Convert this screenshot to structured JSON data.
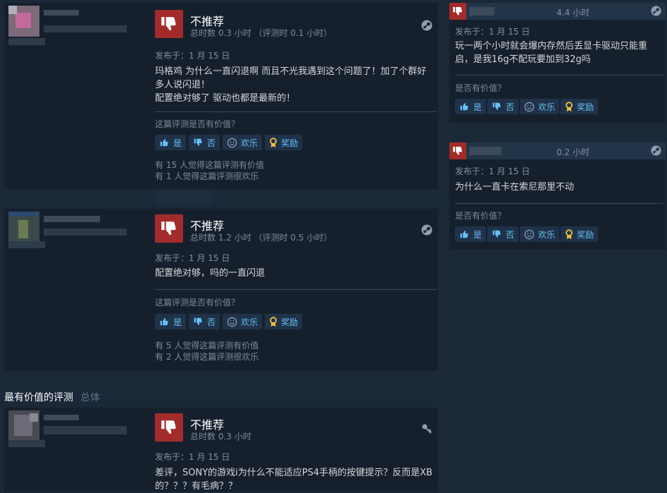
{
  "labels": {
    "not_recommended": "不推荐",
    "helpful_question": "这篇评测是否有价值？",
    "helpful_question_short": "是否有价值？",
    "yes": "是",
    "no": "否",
    "funny": "欢乐",
    "award": "奖励"
  },
  "reviews": [
    {
      "hours": "总时数 0.3 小时 （评测时 0.1 小时）",
      "posted": "发布于：1 月 15 日",
      "text_lines": [
        "玛格鸡 为什么一直闪退啊 而且不光我遇到这个问题了！加了个群好",
        "多人说闪退！",
        "配置绝对够了 驱动也都是最新的！"
      ],
      "helpful_count": "有 15 人觉得这篇评测有价值",
      "funny_count": "有 1 人觉得这篇评测很欢乐"
    },
    {
      "hours": "总时数 1.2 小时 （评测时 0.5 小时）",
      "posted": "发布于：1 月 15 日",
      "text_lines": [
        "配置绝对够，吗的一直闪退"
      ],
      "helpful_count": "有 5 人觉得这篇评测有价值",
      "funny_count": "有 2 人觉得这篇评测很欢乐"
    },
    {
      "hours": "总时数 0.3 小时",
      "posted": "发布于：1 月 15 日",
      "text_lines": [
        "差评，SONY的游戏i为什么不能适应PS4手柄的按键提示？反而是XB",
        "的？？？有毛病？？"
      ]
    }
  ],
  "section": {
    "title": "最有价值的评测",
    "subtitle": "总体"
  },
  "side_reviews": [
    {
      "hours": "4.4 小时",
      "posted": "发布于：1 月 15 日",
      "text_lines": [
        "玩一两个小时就会爆内存然后丢显卡驱动只能重",
        "启，是我16g不配玩要加到32g吗"
      ]
    },
    {
      "hours": "0.2 小时",
      "posted": "发布于：1 月 15 日",
      "text_lines": [
        "为什么一直卡在索尼那里不动"
      ]
    }
  ],
  "colors": {
    "thumb_red": "#a32b2b",
    "link_blue": "#66c0f4",
    "award_gold": "#f0c040"
  }
}
